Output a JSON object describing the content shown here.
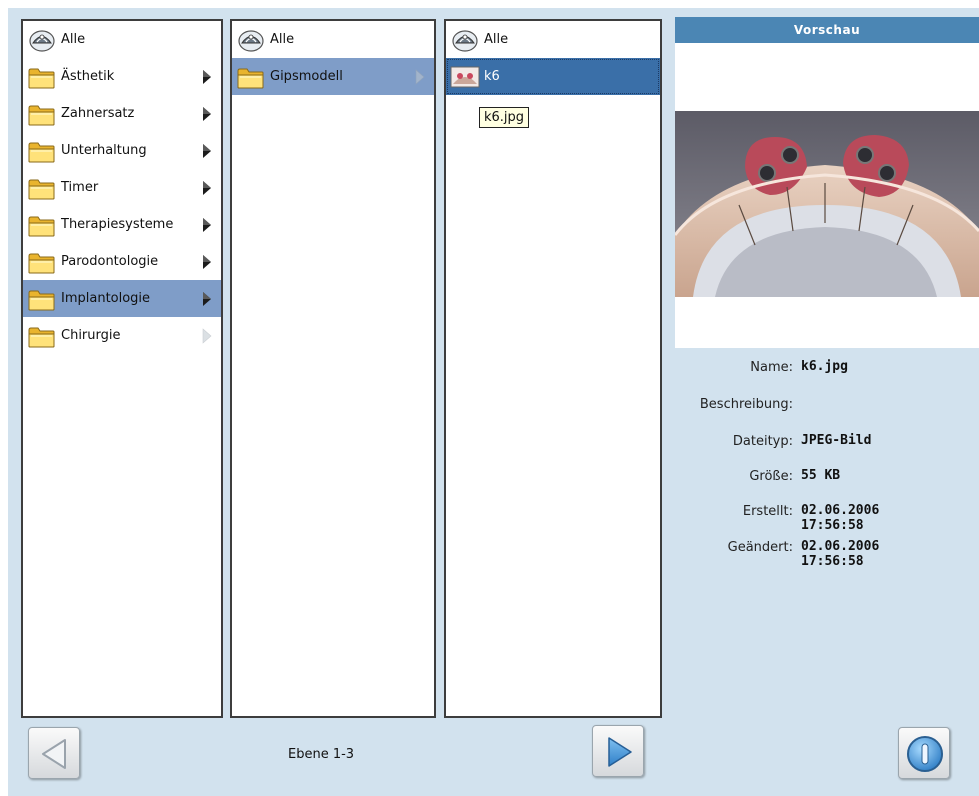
{
  "columns": {
    "level1": {
      "items": [
        {
          "label": "Alle",
          "icon": "all-icon",
          "arrow": "none",
          "state": "normal"
        },
        {
          "label": "Ästhetik",
          "icon": "folder-icon",
          "arrow": "dark",
          "state": "normal"
        },
        {
          "label": "Zahnersatz",
          "icon": "folder-icon",
          "arrow": "dark",
          "state": "normal"
        },
        {
          "label": "Unterhaltung",
          "icon": "folder-icon",
          "arrow": "dark",
          "state": "normal"
        },
        {
          "label": "Timer",
          "icon": "folder-icon",
          "arrow": "dark",
          "state": "normal"
        },
        {
          "label": "Therapiesysteme",
          "icon": "folder-icon",
          "arrow": "dark",
          "state": "normal"
        },
        {
          "label": "Parodontologie",
          "icon": "folder-icon",
          "arrow": "dark",
          "state": "normal"
        },
        {
          "label": "Implantologie",
          "icon": "folder-icon",
          "arrow": "dark",
          "state": "selected"
        },
        {
          "label": "Chirurgie",
          "icon": "folder-icon",
          "arrow": "light",
          "state": "normal"
        }
      ]
    },
    "level2": {
      "items": [
        {
          "label": "Alle",
          "icon": "all-icon",
          "arrow": "none",
          "state": "normal"
        },
        {
          "label": "Gipsmodell",
          "icon": "folder-icon",
          "arrow": "light",
          "state": "selected"
        }
      ]
    },
    "level3": {
      "items": [
        {
          "label": "Alle",
          "icon": "all-icon",
          "arrow": "none",
          "state": "normal"
        },
        {
          "label": "k6",
          "icon": "image-thumbnail-icon",
          "arrow": "none",
          "state": "selected-dark"
        }
      ],
      "tooltip": "k6.jpg"
    }
  },
  "preview": {
    "title": "Vorschau",
    "name_label": "Name:",
    "name_value": "k6.jpg",
    "desc_label": "Beschreibung:",
    "desc_value": "",
    "type_label": "Dateityp:",
    "type_value": "JPEG-Bild",
    "size_label": "Größe:",
    "size_value": "55 KB",
    "created_label": "Erstellt:",
    "created_date": "02.06.2006",
    "created_time": "17:56:58",
    "modified_label": "Geändert:",
    "modified_date": "02.06.2006",
    "modified_time": "17:56:58"
  },
  "footer": {
    "level_label": "Ebene 1-3"
  },
  "colors": {
    "panel_bg": "#d2e2ee",
    "selected_bg": "#7f9dc8",
    "selected_dark_bg": "#3a6fa8",
    "header_bg": "#4b86b4",
    "nav_arrow": "#3c8fd6"
  }
}
